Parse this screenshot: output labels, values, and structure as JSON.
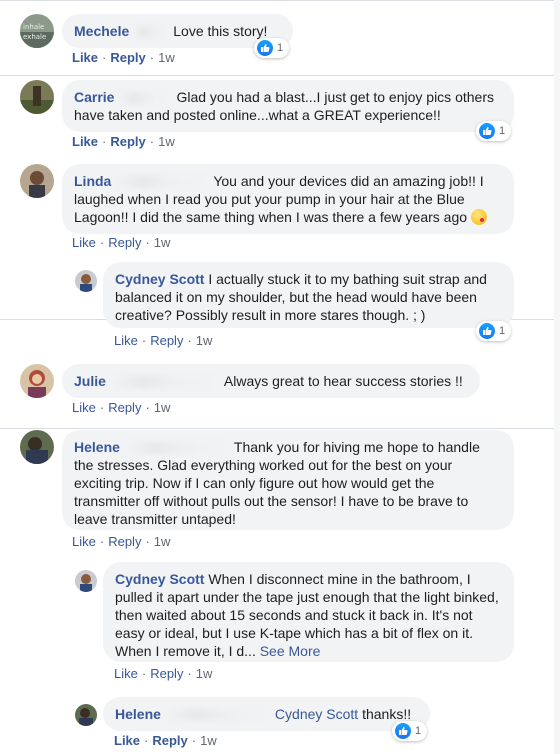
{
  "actions": {
    "like": "Like",
    "reply": "Reply",
    "sep": "·"
  },
  "comments": [
    {
      "name": "Mechele",
      "text": "Love this story!",
      "time": "1w",
      "reactions": "1"
    },
    {
      "name": "Carrie",
      "text": "Glad you had a blast...I just get to enjoy pics others have taken and posted online...what a GREAT experience!!",
      "time": "1w",
      "reactions": "1"
    },
    {
      "name": "Linda",
      "text": "You and your devices did an amazing job!! I laughed when I read you put your pump in your hair at the Blue Lagoon!! I did the same thing when I was there a few years ago",
      "time": "1w"
    },
    {
      "name": "Cydney Scott",
      "text": "I actually stuck it to my bathing suit strap and balanced it on my shoulder, but the head would have been creative? Possibly result in more stares though. ; )",
      "time": "1w",
      "reactions": "1"
    },
    {
      "name": "Julie",
      "text": "Always great to hear success stories !!",
      "time": "1w"
    },
    {
      "name": "Helene",
      "text": "Thank you for hiving me hope to handle the stresses. Glad everything worked out for the best on your exciting trip. Now if I can only figure out how would get the transmitter off without pulls out the sensor! I have to be brave to leave transmitter untaped!",
      "time": "1w"
    },
    {
      "name": "Cydney Scott",
      "text": "When I disconnect mine in the bathroom, I pulled it apart under the tape just enough that the light binked, then waited about 15 seconds and stuck it back in. It's not easy or ideal, but I use K-tape which has a bit of flex on it. When I remove it, I d...",
      "see_more": "See More",
      "time": "1w"
    },
    {
      "name": "Helene",
      "mention": "Cydney Scott",
      "text": "thanks!!",
      "time": "1w",
      "reactions": "1"
    }
  ],
  "colors": {
    "link": "#385898",
    "bubble": "#f2f3f5",
    "like": "#1877f2",
    "muted": "#606770"
  }
}
